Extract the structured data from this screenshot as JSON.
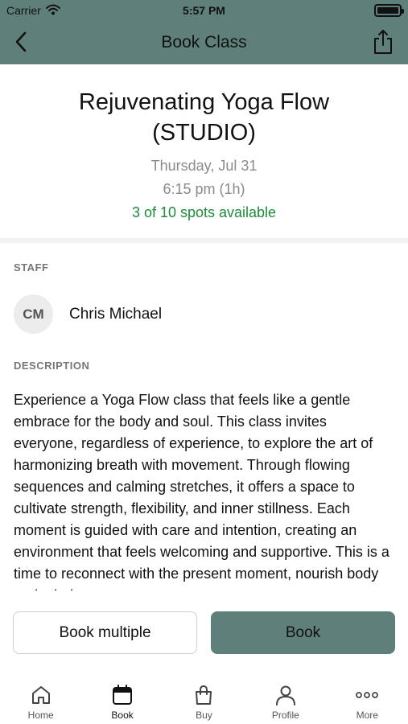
{
  "status_bar": {
    "carrier": "Carrier",
    "time": "5:57 PM"
  },
  "nav": {
    "title": "Book Class",
    "back_icon": "chevron-left-icon",
    "share_icon": "share-icon"
  },
  "class": {
    "title_line1": "Rejuvenating Yoga Flow",
    "title_line2": "(STUDIO)",
    "date": "Thursday, Jul 31",
    "time": "6:15 pm (1h)",
    "spots": "3 of 10 spots available"
  },
  "staff": {
    "label": "STAFF",
    "initials": "CM",
    "name": "Chris Michael"
  },
  "description": {
    "label": "DESCRIPTION",
    "text": "Experience a Yoga Flow class that feels like a gentle embrace for the body and soul. This class invites everyone, regardless of experience, to explore the art of harmonizing breath with movement. Through flowing sequences and calming stretches, it offers a space to cultivate strength, flexibility, and inner stillness. Each moment is guided with care and intention, creating an environment that feels welcoming and supportive. This is a time to reconnect with the present moment, nourish body and mind."
  },
  "actions": {
    "book_multiple": "Book multiple",
    "book": "Book"
  },
  "tabs": [
    {
      "label": "Home",
      "icon": "home-icon"
    },
    {
      "label": "Book",
      "icon": "calendar-icon"
    },
    {
      "label": "Buy",
      "icon": "shopping-bag-icon"
    },
    {
      "label": "Profile",
      "icon": "person-icon"
    },
    {
      "label": "More",
      "icon": "more-icon"
    }
  ],
  "colors": {
    "accent": "#5f7f7a",
    "available": "#1e8a3a",
    "muted": "#8a8a8a"
  }
}
